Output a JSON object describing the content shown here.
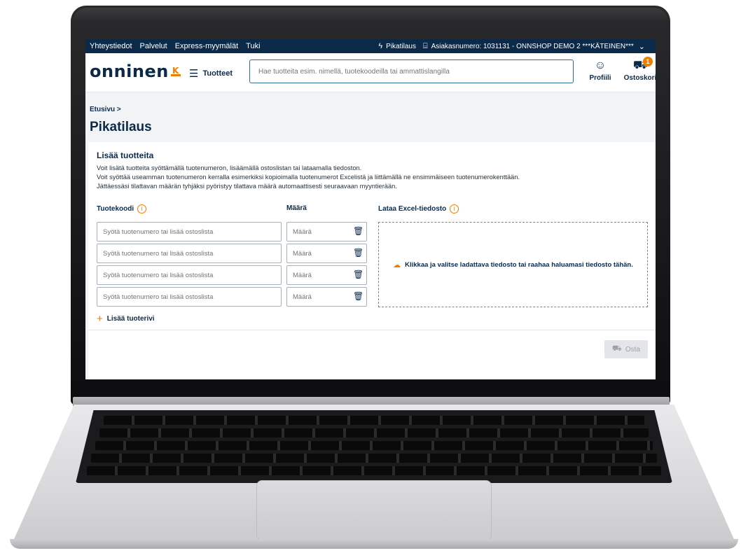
{
  "topbar": {
    "links": [
      "Yhteystiedot",
      "Palvelut",
      "Express-myymälät",
      "Tuki"
    ],
    "quick_order": "Pikatilaus",
    "customer_number": "Asiakasnumero: 1031131 - ONNSHOP DEMO 2 ***KÄTEINEN***"
  },
  "header": {
    "logo": "onninen",
    "menu_label": "Tuotteet",
    "search_placeholder": "Hae tuotteita esim. nimellä, tuotekoodeilla tai ammattislangilla",
    "profile_label": "Profiili",
    "cart_label": "Ostoskori",
    "cart_count": "1"
  },
  "breadcrumb": "Etusivu >",
  "page_title": "Pikatilaus",
  "add_products": {
    "title": "Lisää tuotteita",
    "description": [
      "Voit lisätä tuotteita syöttämällä tuotenumeron, lisäämällä ostoslistan tai lataamalla tiedoston.",
      "Voit syöttää useamman tuotenumeron kerralla esimerkiksi kopioimalla tuotenumerot Excelistä ja liittämällä ne ensimmäiseen tuotenumerokenttään.",
      "Jättäessäsi tilattavan määrän tyhjäksi pyöristyy tilattava määrä automaattisesti seuraavaan myyntierään."
    ],
    "product_code_label": "Tuotekoodi",
    "quantity_label": "Määrä",
    "excel_label": "Lataa Excel-tiedosto",
    "rows": [
      {
        "product_placeholder": "Syötä tuotenumero tai lisää ostoslista",
        "qty_placeholder": "Määrä"
      },
      {
        "product_placeholder": "Syötä tuotenumero tai lisää ostoslista",
        "qty_placeholder": "Määrä"
      },
      {
        "product_placeholder": "Syötä tuotenumero tai lisää ostoslista",
        "qty_placeholder": "Määrä"
      },
      {
        "product_placeholder": "Syötä tuotenumero tai lisää ostoslista",
        "qty_placeholder": "Määrä"
      }
    ],
    "add_row_label": "Lisää tuoterivi",
    "dropzone_text": "Klikkaa ja valitse ladattava tiedosto tai raahaa haluamasi tiedosto tähän.",
    "buy_label": "Osta"
  },
  "colors": {
    "navy": "#0b2a4a",
    "accent": "#f07d00"
  },
  "icons": [
    "bolt-icon",
    "briefcase-icon",
    "chevron-down-icon",
    "menu-icon",
    "profile-icon",
    "cart-icon",
    "info-icon",
    "trash-icon",
    "plus-icon",
    "cloud-upload-icon"
  ]
}
